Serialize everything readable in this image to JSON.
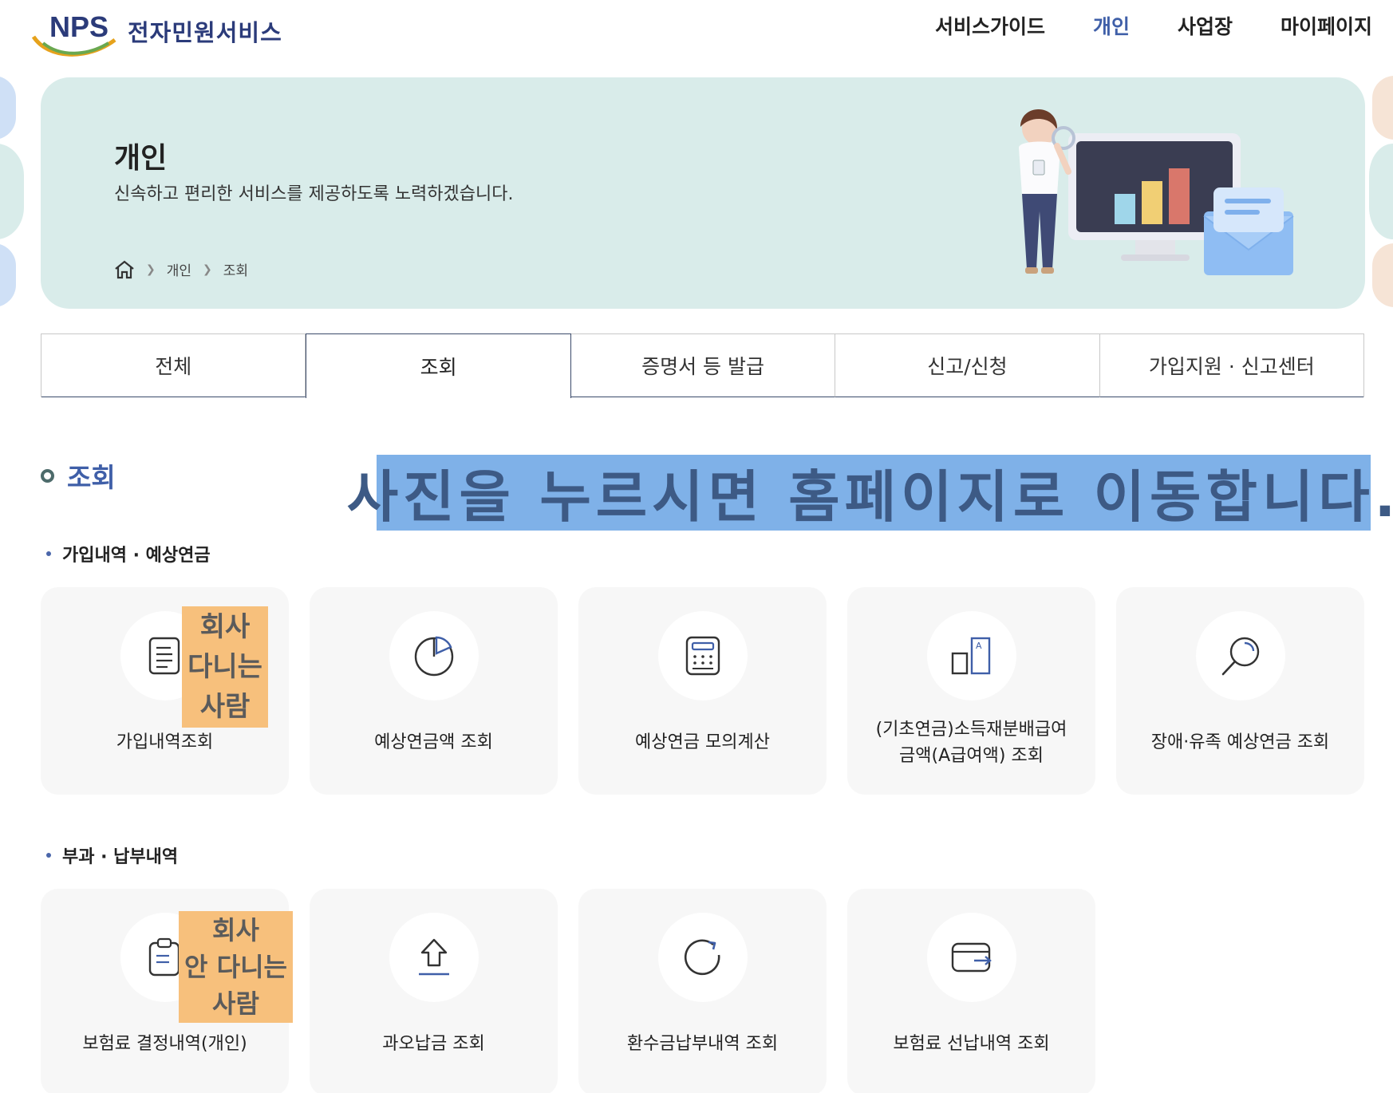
{
  "header": {
    "logo_mark": "NPS",
    "logo_text": "전자민원서비스",
    "nav": [
      "서비스가이드",
      "개인",
      "사업장",
      "마이페이지"
    ]
  },
  "banner": {
    "title": "개인",
    "subtitle": "신속하고 편리한 서비스를 제공하도록 노력하겠습니다.",
    "breadcrumb": [
      "개인",
      "조회"
    ]
  },
  "tabs": [
    "전체",
    "조회",
    "증명서 등 발급",
    "신고/신청",
    "가입지원 · 신고센터"
  ],
  "section": {
    "title": "조회",
    "notice": "사진을 누르시면 홈페이지로 이동합니다."
  },
  "group1": {
    "title": "가입내역 · 예상연금",
    "cards": [
      {
        "label": "가입내역조회",
        "icon": "document-list-icon"
      },
      {
        "label": "예상연금액 조회",
        "icon": "pie-chart-icon"
      },
      {
        "label": "예상연금 모의계산",
        "icon": "calculator-icon"
      },
      {
        "label_line1": "(기초연금)소득재분배급여",
        "label_line2": "금액(A급여액) 조회",
        "icon": "compare-bars-icon"
      },
      {
        "label": "장애·유족 예상연금 조회",
        "icon": "magnifier-icon"
      }
    ],
    "sticker": [
      "회사",
      "다니는",
      "사람"
    ]
  },
  "group2": {
    "title": "부과 · 납부내역",
    "cards": [
      {
        "label": "보험료 결정내역(개인)",
        "icon": "clipboard-icon"
      },
      {
        "label": "과오납금 조회",
        "icon": "upload-arrow-icon"
      },
      {
        "label": "환수금납부내역 조회",
        "icon": "refresh-icon"
      },
      {
        "label": "보험료 선납내역 조회",
        "icon": "wallet-icon"
      }
    ],
    "sticker": [
      "회사",
      "안 다니는",
      "사람"
    ]
  },
  "colors": {
    "brand": "#2b3b7a",
    "accent": "#3f5fa8",
    "banner_bg": "#d9ecea",
    "notice_bg": "#7fb1e8",
    "sticker_bg": "#f7c07c",
    "card_bg": "#f7f7f7"
  }
}
